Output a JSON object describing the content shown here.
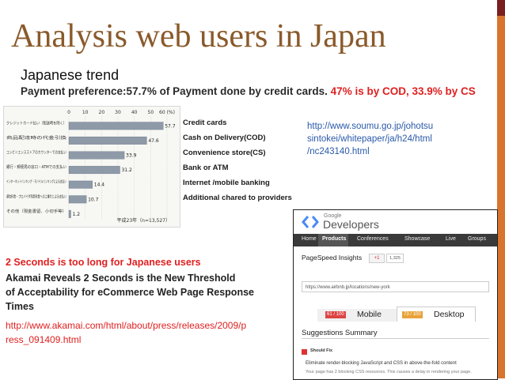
{
  "slide": {
    "title": "Analysis web users in Japan",
    "subtitle": "Japanese trend",
    "payment_line": {
      "part1": "Payment preference:57.7% of Payment done by credit cards.",
      "part2": "47% is by COD, 33.9% by CS"
    }
  },
  "chart_data": {
    "type": "bar",
    "orientation": "horizontal",
    "categories": [
      "クレジットカード払い（配送時を除く）",
      "商品配達時の代金引換",
      "コンビニエンスストアのカウンターでの支払い",
      "銀行・郵便局の窓口・ATMでの支払い",
      "インターネットバンキング・モバイルバンキングによる支払い",
      "通信料金・プロバイダ利用料金への上乗せによる支払い",
      "その他（現金書留、小切手等）"
    ],
    "values": [
      57.7,
      47.6,
      33.9,
      31.2,
      14.4,
      10.7,
      1.2
    ],
    "value_labels": [
      "57.7",
      "47.6",
      "33.9",
      "31.2",
      "14.4",
      "10.7",
      "1.2"
    ],
    "xlim": [
      0,
      60
    ],
    "x_ticks": [
      "0",
      "10",
      "20",
      "30",
      "40",
      "50",
      "60 (%)"
    ],
    "x_tick_values": [
      0,
      10,
      20,
      30,
      40,
      50,
      60
    ],
    "annotation": "平成23年（n=13,527）",
    "grid": true,
    "bar_color": "#8e9aa8"
  },
  "legend": [
    "Credit cards",
    "Cash on Delivery(COD)",
    "Convenience store(CS)",
    "Bank or ATM",
    "Internet /mobile banking",
    "Additional chared to providers"
  ],
  "source_link": [
    "http://www.soumu.go.jp/johotsu",
    "sintokei/whitepaper/ja/h24/html",
    "/nc243140.html"
  ],
  "speed": {
    "heading": "2 Seconds is too long for Japanese users",
    "akamai_lines": [
      "Akamai Reveals 2 Seconds is the New Threshold",
      " of Acceptability for eCommerce Web Page Response",
      "Times"
    ],
    "link_lines": [
      "http://www.akamai.com/html/about/press/releases/2009/p",
      "ress_091409.html"
    ]
  },
  "google_dev": {
    "google": "Google",
    "developers": "Developers",
    "nav": [
      "Home",
      "Products",
      "Conferences",
      "Showcase",
      "Live",
      "Groups"
    ],
    "page_title": "PageSpeed Insights",
    "plus_label": "+1",
    "plus_count": "1,325",
    "url_value": "https://www.airbnb.jp/locations/new-york",
    "mobile_score": "61 / 100",
    "mobile_label": "Mobile",
    "desktop_score": "73 / 100",
    "desktop_label": "Desktop",
    "suggestions_title": "Suggestions Summary",
    "should_fix": "Should Fix",
    "eliminate": "Eliminate render-blocking JavaScript and CSS in above-the-fold content",
    "note": "Your page has 2 blocking CSS resources. This causes a delay in rendering your page."
  },
  "colors": {
    "title": "#8a5a2b",
    "accent_red": "#e02020",
    "link_blue": "#2a5aaa",
    "side_bar": "#d9742f"
  }
}
